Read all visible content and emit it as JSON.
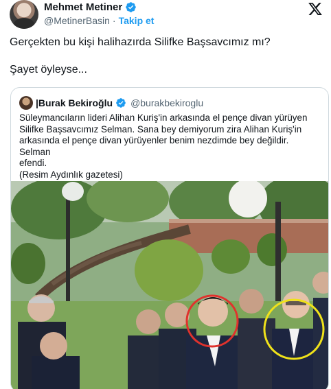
{
  "tweet": {
    "author": "Mehmet Metiner",
    "handle": "@MetinerBasin",
    "separator": "·",
    "follow_label": "Takip et",
    "text_lines": [
      "Gerçekten bu kişi halihazırda Silifke Başsavcımız mı?",
      "Şayet öyleyse..."
    ]
  },
  "quoted": {
    "author": "|Burak Bekiroğlu",
    "handle": "@burakbekiroglu",
    "text_lines": [
      "Süleymancıların lideri Alihan Kuriş'in arkasında el pençe divan yürüyen",
      "Silifke Başsavcımız Selman. Sana bey demiyorum zira Alihan Kuriş'in",
      "arkasında el pençe divan yürüyenler benim nezdimde bey değildir. Selman",
      "efendi.",
      "(Resim Aydınlık gazetesi)"
    ]
  },
  "colors": {
    "accent": "#1d9bf0",
    "text": "#0f1419",
    "secondary": "#536471",
    "border": "#cfd9de",
    "highlight_red": "#e0322d",
    "highlight_yellow": "#f0e21a"
  },
  "icons": [
    "verified-badge-icon",
    "x-logo-icon"
  ]
}
